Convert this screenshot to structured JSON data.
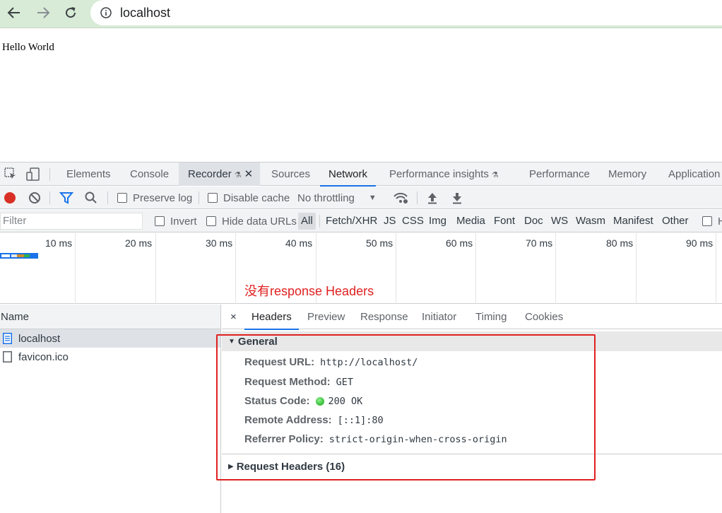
{
  "browser": {
    "url": "localhost",
    "icons": [
      "back-arrow-icon",
      "forward-arrow-icon",
      "reload-icon",
      "info-icon"
    ]
  },
  "page": {
    "text": "Hello World"
  },
  "devtools": {
    "tabs": [
      "Elements",
      "Console",
      "Recorder",
      "Sources",
      "Network",
      "Performance insights",
      "Performance",
      "Memory",
      "Application"
    ],
    "active_tab": "Network",
    "toolbar": {
      "preserve_log": "Preserve log",
      "disable_cache": "Disable cache",
      "throttling": "No throttling",
      "throttling_arrow": "▼"
    },
    "filter": {
      "placeholder": "Filter",
      "invert": "Invert",
      "hide_data_urls": "Hide data URLs",
      "types": [
        "All",
        "Fetch/XHR",
        "JS",
        "CSS",
        "Img",
        "Media",
        "Font",
        "Doc",
        "WS",
        "Wasm",
        "Manifest",
        "Other"
      ],
      "cut_label": "H"
    },
    "timeline": {
      "ticks": [
        "10 ms",
        "20 ms",
        "30 ms",
        "40 ms",
        "50 ms",
        "60 ms",
        "70 ms",
        "80 ms",
        "90 ms"
      ]
    },
    "annotation": "没有response Headers",
    "requests": {
      "header": "Name",
      "items": [
        "localhost",
        "favicon.ico"
      ],
      "selected": "localhost"
    },
    "detail": {
      "close": "×",
      "tabs": [
        "Headers",
        "Preview",
        "Response",
        "Initiator",
        "Timing",
        "Cookies"
      ],
      "active_tab": "Headers",
      "general": {
        "title": "General",
        "request_url_label": "Request URL:",
        "request_url": "http://localhost/",
        "method_label": "Request Method:",
        "method": "GET",
        "status_label": "Status Code:",
        "status": "200 OK",
        "remote_label": "Remote Address:",
        "remote": "[::1]:80",
        "referrer_label": "Referrer Policy:",
        "referrer": "strict-origin-when-cross-origin"
      },
      "request_headers": "Request Headers (16)"
    }
  },
  "colors": {
    "accent": "#1a73e8",
    "annotation": "#e02020",
    "status_ok": "#0ca40c",
    "record": "#d93025"
  }
}
